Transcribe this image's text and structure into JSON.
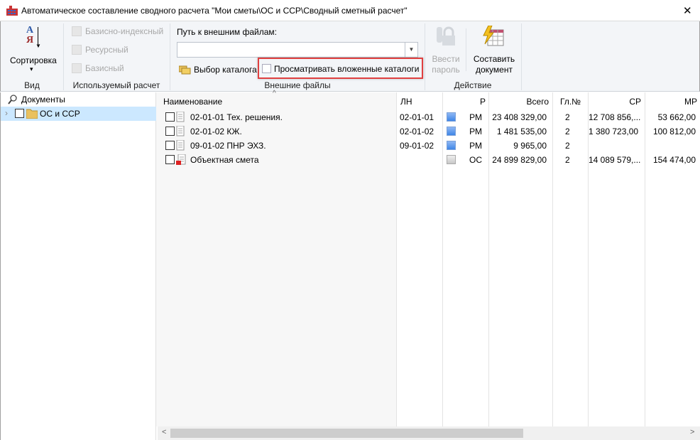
{
  "window": {
    "title": "Автоматическое составление сводного расчета \"Мои сметы\\ОС и ССР\\Сводный сметный расчет\"",
    "close": "✕"
  },
  "ribbon": {
    "view": {
      "sort_label": "Сортировка",
      "sort_arrow": "▾",
      "group": "Вид",
      "sort_icon_top": "А",
      "sort_icon_bottom": "Я"
    },
    "calc": {
      "items": [
        "Базисно-индексный",
        "Ресурсный",
        "Базисный"
      ],
      "group": "Используемый расчет"
    },
    "files": {
      "path_label": "Путь к внешним файлам:",
      "path_value": "",
      "choose_dir": "Выбор каталога",
      "nested": "Просматривать вложенные каталоги",
      "group": "Внешние файлы"
    },
    "action": {
      "password": [
        "Ввести",
        "пароль"
      ],
      "compose": [
        "Составить",
        "документ"
      ],
      "group": "Действие"
    }
  },
  "tree": {
    "root": "Документы",
    "items": [
      {
        "label": "ОС и ССР"
      }
    ]
  },
  "table": {
    "headers": [
      "Наименование",
      "ЛН",
      "Р",
      "Всего",
      "Гл.№",
      "СР",
      "МР"
    ],
    "rows": [
      {
        "name": "02-01-01 Тех. решения.",
        "ln": "02-01-01",
        "r": "РМ",
        "total": "23 408 329,00",
        "gl": "2",
        "sr": "12 708 856,...",
        "mr": "53 662,00",
        "kind": "rm"
      },
      {
        "name": "02-01-02  КЖ.",
        "ln": "02-01-02",
        "r": "РМ",
        "total": "1 481 535,00",
        "gl": "2",
        "sr": "1 380 723,00",
        "mr": "100 812,00",
        "kind": "rm"
      },
      {
        "name": "09-01-02  ПНР ЭХЗ.",
        "ln": "09-01-02",
        "r": "РМ",
        "total": "9 965,00",
        "gl": "2",
        "sr": "",
        "mr": "",
        "kind": "rm"
      },
      {
        "name": "Объектная смета",
        "ln": "",
        "r": "ОС",
        "total": "24 899 829,00",
        "gl": "2",
        "sr": "14 089 579,...",
        "mr": "154 474,00",
        "kind": "os"
      }
    ]
  },
  "colors": {
    "highlight": "#e04040",
    "selection": "#cce8ff",
    "swatch_blue": "#3f86e6"
  }
}
